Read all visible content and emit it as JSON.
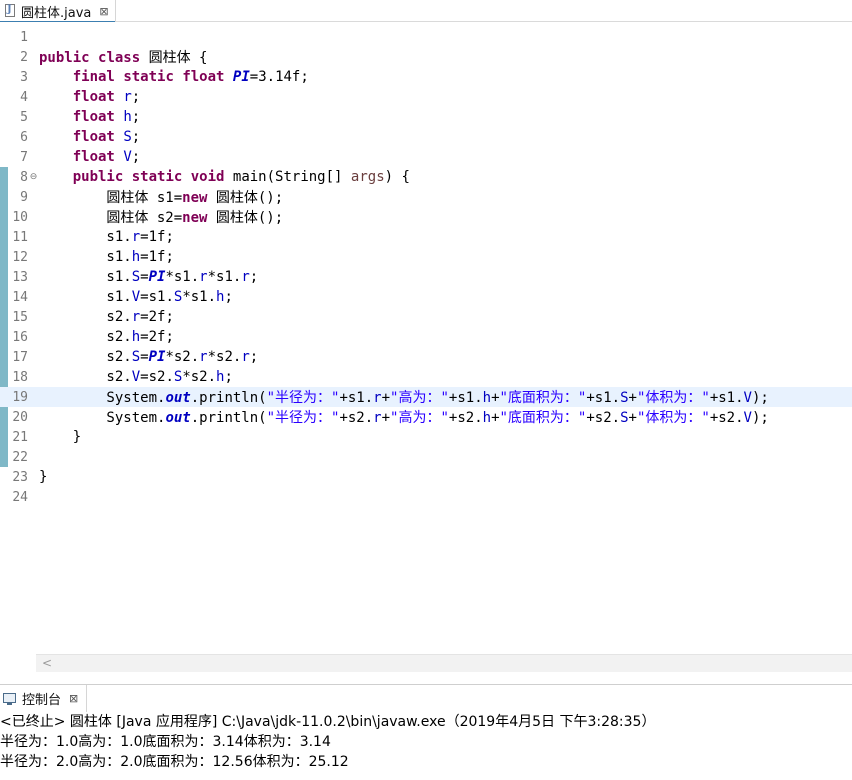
{
  "editor_tab": {
    "title": "圆柱体.java",
    "close_glyph": "⊠"
  },
  "lines": [
    {
      "num": "1",
      "fold": "",
      "current": false,
      "tokens": []
    },
    {
      "num": "2",
      "fold": "",
      "current": false,
      "tokens": [
        {
          "t": "kw",
          "v": "public"
        },
        {
          "t": "p",
          "v": " "
        },
        {
          "t": "kw",
          "v": "class"
        },
        {
          "t": "p",
          "v": " 圆柱体 {"
        }
      ]
    },
    {
      "num": "3",
      "fold": "",
      "current": false,
      "tokens": [
        {
          "t": "p",
          "v": "    "
        },
        {
          "t": "kw",
          "v": "final"
        },
        {
          "t": "p",
          "v": " "
        },
        {
          "t": "kw",
          "v": "static"
        },
        {
          "t": "p",
          "v": " "
        },
        {
          "t": "kw",
          "v": "float"
        },
        {
          "t": "p",
          "v": " "
        },
        {
          "t": "sfld",
          "v": "PI"
        },
        {
          "t": "p",
          "v": "=3.14f;"
        }
      ]
    },
    {
      "num": "4",
      "fold": "",
      "current": false,
      "tokens": [
        {
          "t": "p",
          "v": "    "
        },
        {
          "t": "kw",
          "v": "float"
        },
        {
          "t": "p",
          "v": " "
        },
        {
          "t": "fld",
          "v": "r"
        },
        {
          "t": "p",
          "v": ";"
        }
      ]
    },
    {
      "num": "5",
      "fold": "",
      "current": false,
      "tokens": [
        {
          "t": "p",
          "v": "    "
        },
        {
          "t": "kw",
          "v": "float"
        },
        {
          "t": "p",
          "v": " "
        },
        {
          "t": "fld",
          "v": "h"
        },
        {
          "t": "p",
          "v": ";"
        }
      ]
    },
    {
      "num": "6",
      "fold": "",
      "current": false,
      "tokens": [
        {
          "t": "p",
          "v": "    "
        },
        {
          "t": "kw",
          "v": "float"
        },
        {
          "t": "p",
          "v": " "
        },
        {
          "t": "fld",
          "v": "S"
        },
        {
          "t": "p",
          "v": ";"
        }
      ]
    },
    {
      "num": "7",
      "fold": "",
      "current": false,
      "tokens": [
        {
          "t": "p",
          "v": "    "
        },
        {
          "t": "kw",
          "v": "float"
        },
        {
          "t": "p",
          "v": " "
        },
        {
          "t": "fld",
          "v": "V"
        },
        {
          "t": "p",
          "v": ";"
        }
      ]
    },
    {
      "num": "8",
      "fold": "⊖",
      "current": false,
      "tokens": [
        {
          "t": "p",
          "v": "    "
        },
        {
          "t": "kw",
          "v": "public"
        },
        {
          "t": "p",
          "v": " "
        },
        {
          "t": "kw",
          "v": "static"
        },
        {
          "t": "p",
          "v": " "
        },
        {
          "t": "kw",
          "v": "void"
        },
        {
          "t": "p",
          "v": " main(String[] "
        },
        {
          "t": "prm",
          "v": "args"
        },
        {
          "t": "p",
          "v": ") {"
        }
      ]
    },
    {
      "num": "9",
      "fold": "",
      "current": false,
      "tokens": [
        {
          "t": "p",
          "v": "        圆柱体 s1="
        },
        {
          "t": "kw",
          "v": "new"
        },
        {
          "t": "p",
          "v": " 圆柱体();"
        }
      ]
    },
    {
      "num": "10",
      "fold": "",
      "current": false,
      "tokens": [
        {
          "t": "p",
          "v": "        圆柱体 s2="
        },
        {
          "t": "kw",
          "v": "new"
        },
        {
          "t": "p",
          "v": " 圆柱体();"
        }
      ]
    },
    {
      "num": "11",
      "fold": "",
      "current": false,
      "tokens": [
        {
          "t": "p",
          "v": "        s1."
        },
        {
          "t": "fld",
          "v": "r"
        },
        {
          "t": "p",
          "v": "=1f;"
        }
      ]
    },
    {
      "num": "12",
      "fold": "",
      "current": false,
      "tokens": [
        {
          "t": "p",
          "v": "        s1."
        },
        {
          "t": "fld",
          "v": "h"
        },
        {
          "t": "p",
          "v": "=1f;"
        }
      ]
    },
    {
      "num": "13",
      "fold": "",
      "current": false,
      "tokens": [
        {
          "t": "p",
          "v": "        s1."
        },
        {
          "t": "fld",
          "v": "S"
        },
        {
          "t": "p",
          "v": "="
        },
        {
          "t": "sfld",
          "v": "PI"
        },
        {
          "t": "p",
          "v": "*s1."
        },
        {
          "t": "fld",
          "v": "r"
        },
        {
          "t": "p",
          "v": "*s1."
        },
        {
          "t": "fld",
          "v": "r"
        },
        {
          "t": "p",
          "v": ";"
        }
      ]
    },
    {
      "num": "14",
      "fold": "",
      "current": false,
      "tokens": [
        {
          "t": "p",
          "v": "        s1."
        },
        {
          "t": "fld",
          "v": "V"
        },
        {
          "t": "p",
          "v": "=s1."
        },
        {
          "t": "fld",
          "v": "S"
        },
        {
          "t": "p",
          "v": "*s1."
        },
        {
          "t": "fld",
          "v": "h"
        },
        {
          "t": "p",
          "v": ";"
        }
      ]
    },
    {
      "num": "15",
      "fold": "",
      "current": false,
      "tokens": [
        {
          "t": "p",
          "v": "        s2."
        },
        {
          "t": "fld",
          "v": "r"
        },
        {
          "t": "p",
          "v": "=2f;"
        }
      ]
    },
    {
      "num": "16",
      "fold": "",
      "current": false,
      "tokens": [
        {
          "t": "p",
          "v": "        s2."
        },
        {
          "t": "fld",
          "v": "h"
        },
        {
          "t": "p",
          "v": "=2f;"
        }
      ]
    },
    {
      "num": "17",
      "fold": "",
      "current": false,
      "tokens": [
        {
          "t": "p",
          "v": "        s2."
        },
        {
          "t": "fld",
          "v": "S"
        },
        {
          "t": "p",
          "v": "="
        },
        {
          "t": "sfld",
          "v": "PI"
        },
        {
          "t": "p",
          "v": "*s2."
        },
        {
          "t": "fld",
          "v": "r"
        },
        {
          "t": "p",
          "v": "*s2."
        },
        {
          "t": "fld",
          "v": "r"
        },
        {
          "t": "p",
          "v": ";"
        }
      ]
    },
    {
      "num": "18",
      "fold": "",
      "current": false,
      "tokens": [
        {
          "t": "p",
          "v": "        s2."
        },
        {
          "t": "fld",
          "v": "V"
        },
        {
          "t": "p",
          "v": "=s2."
        },
        {
          "t": "fld",
          "v": "S"
        },
        {
          "t": "p",
          "v": "*s2."
        },
        {
          "t": "fld",
          "v": "h"
        },
        {
          "t": "p",
          "v": ";"
        }
      ]
    },
    {
      "num": "19",
      "fold": "",
      "current": true,
      "tokens": [
        {
          "t": "p",
          "v": "        System."
        },
        {
          "t": "sout",
          "v": "out"
        },
        {
          "t": "p",
          "v": ".println("
        },
        {
          "t": "str",
          "v": "\"半径为：\""
        },
        {
          "t": "p",
          "v": "+s1."
        },
        {
          "t": "fld",
          "v": "r"
        },
        {
          "t": "p",
          "v": "+"
        },
        {
          "t": "str",
          "v": "\"高为：\""
        },
        {
          "t": "p",
          "v": "+s1."
        },
        {
          "t": "fld",
          "v": "h"
        },
        {
          "t": "p",
          "v": "+"
        },
        {
          "t": "str",
          "v": "\"底面积为：\""
        },
        {
          "t": "p",
          "v": "+s1."
        },
        {
          "t": "fld",
          "v": "S"
        },
        {
          "t": "p",
          "v": "+"
        },
        {
          "t": "str",
          "v": "\"体积为：\""
        },
        {
          "t": "p",
          "v": "+s1."
        },
        {
          "t": "fld",
          "v": "V"
        },
        {
          "t": "p",
          "v": ");"
        }
      ]
    },
    {
      "num": "20",
      "fold": "",
      "current": false,
      "tokens": [
        {
          "t": "p",
          "v": "        System."
        },
        {
          "t": "sout",
          "v": "out"
        },
        {
          "t": "p",
          "v": ".println("
        },
        {
          "t": "str",
          "v": "\"半径为：\""
        },
        {
          "t": "p",
          "v": "+s2."
        },
        {
          "t": "fld",
          "v": "r"
        },
        {
          "t": "p",
          "v": "+"
        },
        {
          "t": "str",
          "v": "\"高为：\""
        },
        {
          "t": "p",
          "v": "+s2."
        },
        {
          "t": "fld",
          "v": "h"
        },
        {
          "t": "p",
          "v": "+"
        },
        {
          "t": "str",
          "v": "\"底面积为：\""
        },
        {
          "t": "p",
          "v": "+s2."
        },
        {
          "t": "fld",
          "v": "S"
        },
        {
          "t": "p",
          "v": "+"
        },
        {
          "t": "str",
          "v": "\"体积为：\""
        },
        {
          "t": "p",
          "v": "+s2."
        },
        {
          "t": "fld",
          "v": "V"
        },
        {
          "t": "p",
          "v": ");"
        }
      ]
    },
    {
      "num": "21",
      "fold": "",
      "current": false,
      "tokens": [
        {
          "t": "p",
          "v": "    }"
        }
      ]
    },
    {
      "num": "22",
      "fold": "",
      "current": false,
      "tokens": []
    },
    {
      "num": "23",
      "fold": "",
      "current": false,
      "tokens": [
        {
          "t": "p",
          "v": "}"
        }
      ]
    },
    {
      "num": "24",
      "fold": "",
      "current": false,
      "tokens": []
    }
  ],
  "scrollbar": {
    "left_arrow": "<"
  },
  "console": {
    "tab_title": "控制台",
    "close_glyph": "⊠",
    "status": "<已终止> 圆柱体 [Java 应用程序] C:\\Java\\jdk-11.0.2\\bin\\javaw.exe（2019年4月5日 下午3:28:35）",
    "output": [
      "半径为：1.0高为：1.0底面积为：3.14体积为：3.14",
      "半径为：2.0高为：2.0底面积为：12.56体积为：25.12"
    ]
  },
  "colors": {
    "keyword": "#7f0055",
    "field": "#0000c0",
    "string": "#2a00ff",
    "current_line": "#e8f2fe",
    "change_ruler": "#7fb8c7"
  }
}
